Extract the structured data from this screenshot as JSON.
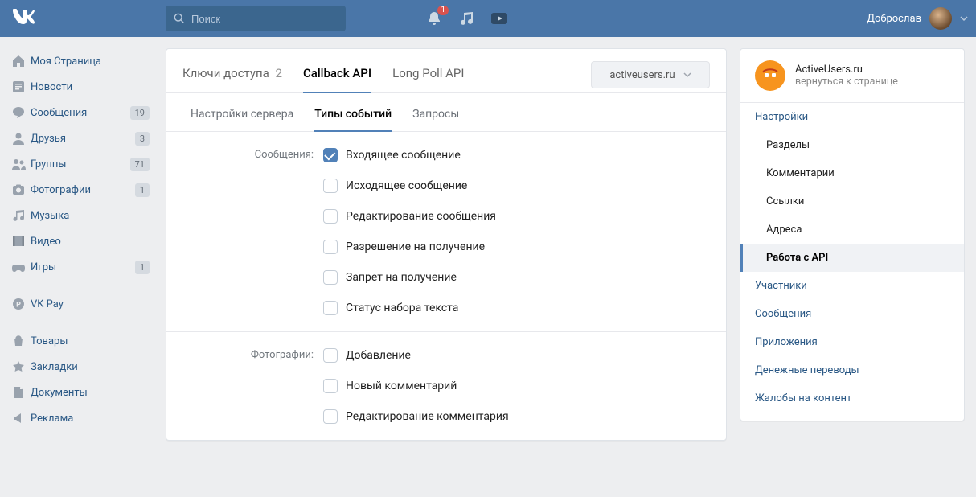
{
  "header": {
    "search_placeholder": "Поиск",
    "notification_badge": "1",
    "username": "Доброслав"
  },
  "leftnav": {
    "items": [
      {
        "icon": "home",
        "label": "Моя Страница",
        "counter": null
      },
      {
        "icon": "news",
        "label": "Новости",
        "counter": null
      },
      {
        "icon": "msg",
        "label": "Сообщения",
        "counter": "19"
      },
      {
        "icon": "user",
        "label": "Друзья",
        "counter": "3"
      },
      {
        "icon": "group",
        "label": "Группы",
        "counter": "71"
      },
      {
        "icon": "photo",
        "label": "Фотографии",
        "counter": "1"
      },
      {
        "icon": "music",
        "label": "Музыка",
        "counter": null
      },
      {
        "icon": "video",
        "label": "Видео",
        "counter": null
      },
      {
        "icon": "game",
        "label": "Игры",
        "counter": "1"
      }
    ],
    "secondary": [
      {
        "icon": "pay",
        "label": "VK Pay"
      }
    ],
    "tertiary": [
      {
        "icon": "bag",
        "label": "Товары"
      },
      {
        "icon": "star",
        "label": "Закладки"
      },
      {
        "icon": "doc",
        "label": "Документы"
      },
      {
        "icon": "ad",
        "label": "Реклама"
      }
    ]
  },
  "tabs_top": [
    {
      "label": "Ключи доступа",
      "count": "2",
      "active": false
    },
    {
      "label": "Callback API",
      "count": null,
      "active": true
    },
    {
      "label": "Long Poll API",
      "count": null,
      "active": false
    }
  ],
  "dropdown_label": "activeusers.ru",
  "tabs_sub": [
    {
      "label": "Настройки сервера",
      "active": false
    },
    {
      "label": "Типы событий",
      "active": true
    },
    {
      "label": "Запросы",
      "active": false
    }
  ],
  "sections": [
    {
      "title": "Сообщения:",
      "options": [
        {
          "label": "Входящее сообщение",
          "checked": true
        },
        {
          "label": "Исходящее сообщение",
          "checked": false
        },
        {
          "label": "Редактирование сообщения",
          "checked": false
        },
        {
          "label": "Разрешение на получение",
          "checked": false
        },
        {
          "label": "Запрет на получение",
          "checked": false
        },
        {
          "label": "Статус набора текста",
          "checked": false
        }
      ]
    },
    {
      "title": "Фотографии:",
      "options": [
        {
          "label": "Добавление",
          "checked": false
        },
        {
          "label": "Новый комментарий",
          "checked": false
        },
        {
          "label": "Редактирование комментария",
          "checked": false
        }
      ]
    }
  ],
  "right": {
    "card_title": "ActiveUsers.ru",
    "card_sub": "вернуться к странице",
    "links": [
      {
        "label": "Настройки",
        "sub": false,
        "active": false
      },
      {
        "label": "Разделы",
        "sub": true,
        "active": false
      },
      {
        "label": "Комментарии",
        "sub": true,
        "active": false
      },
      {
        "label": "Ссылки",
        "sub": true,
        "active": false
      },
      {
        "label": "Адреса",
        "sub": true,
        "active": false
      },
      {
        "label": "Работа с API",
        "sub": true,
        "active": true
      },
      {
        "label": "Участники",
        "sub": false,
        "active": false
      },
      {
        "label": "Сообщения",
        "sub": false,
        "active": false
      },
      {
        "label": "Приложения",
        "sub": false,
        "active": false
      },
      {
        "label": "Денежные переводы",
        "sub": false,
        "active": false
      },
      {
        "label": "Жалобы на контент",
        "sub": false,
        "active": false
      }
    ]
  }
}
